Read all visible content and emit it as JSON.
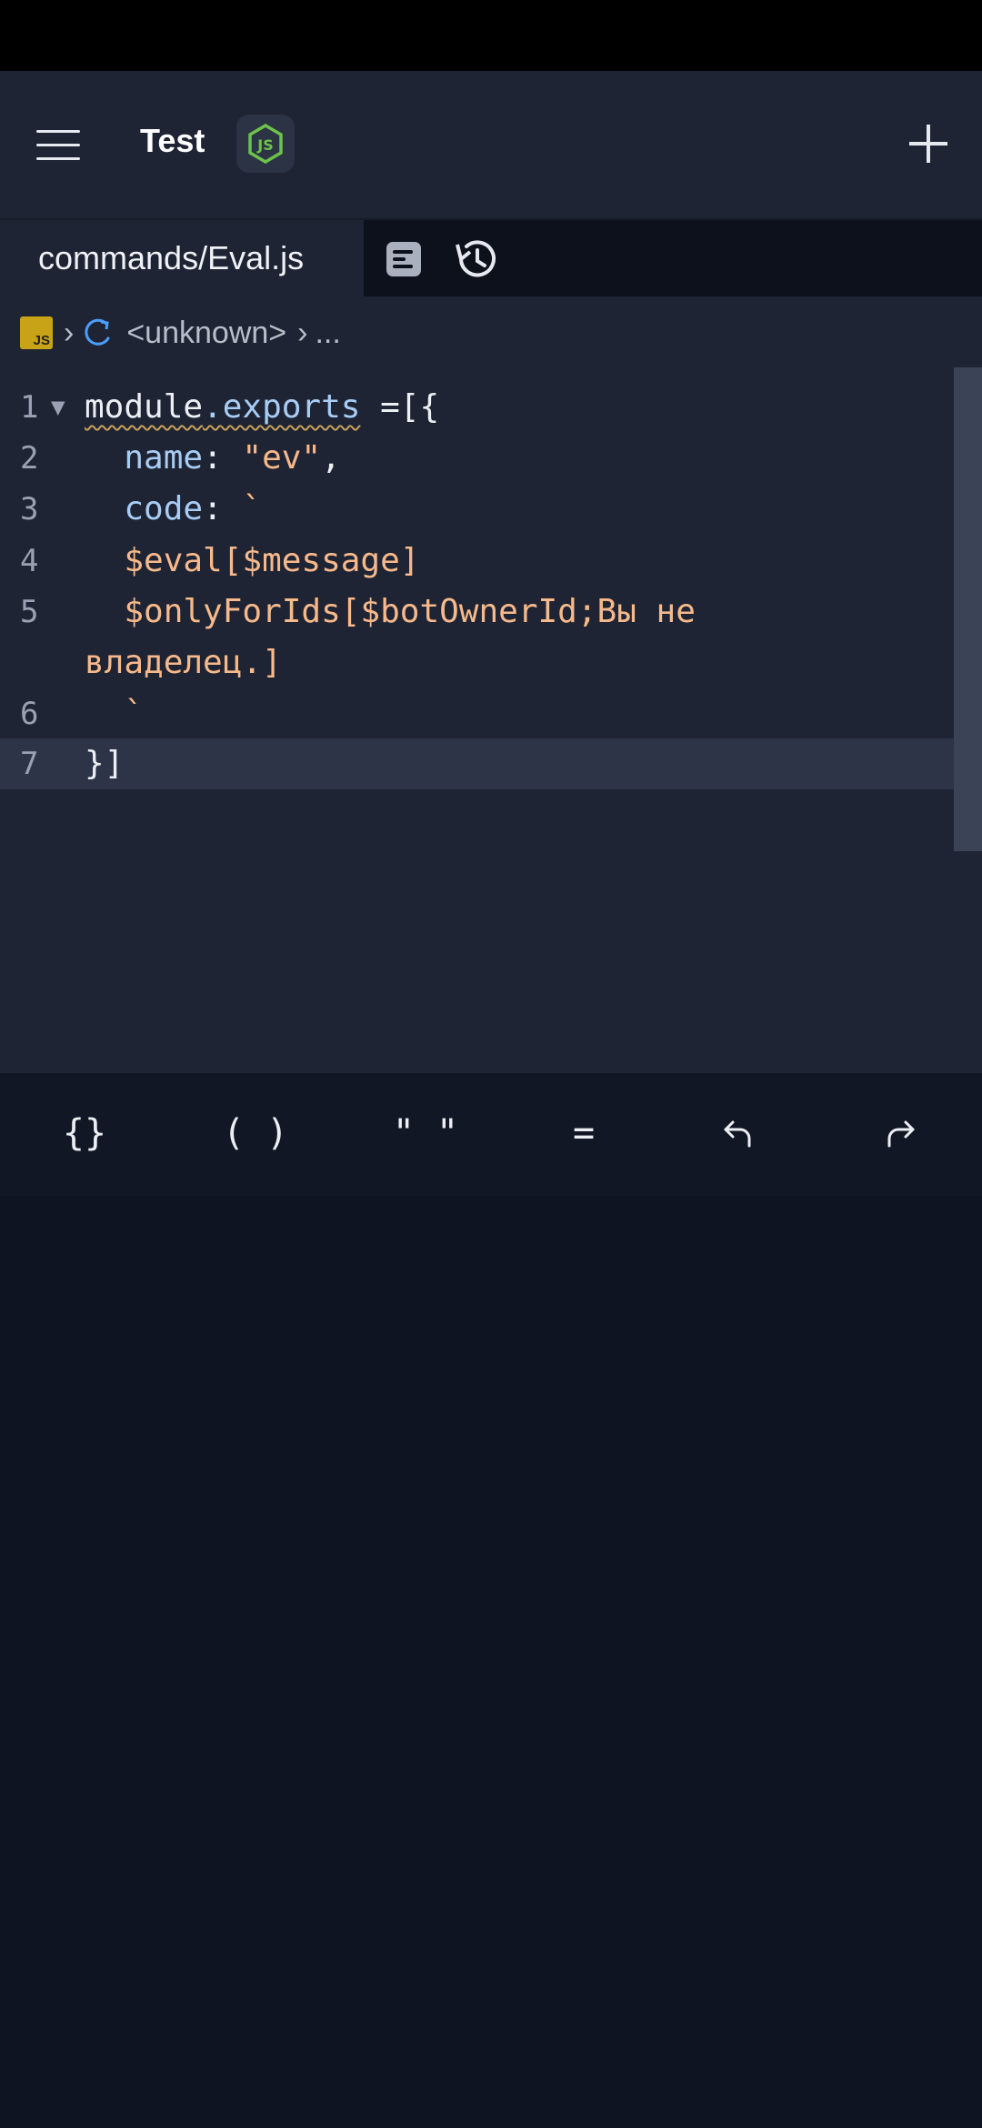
{
  "header": {
    "project_title": "Test",
    "runtime_icon": "nodejs-icon",
    "menu_icon": "hamburger-icon",
    "add_icon": "plus-icon"
  },
  "tabs": {
    "active_file": "commands/Eval.js",
    "icons": [
      "format-icon",
      "history-icon"
    ]
  },
  "breadcrumb": {
    "file_type_badge": "JS",
    "symbol_icon": "refresh-icon",
    "segment": "<unknown>",
    "ellipsis": "..."
  },
  "editor": {
    "lines": [
      {
        "number": "1"
      },
      {
        "number": "2"
      },
      {
        "number": "3"
      },
      {
        "number": "4"
      },
      {
        "number": "5"
      },
      {
        "number": "6"
      },
      {
        "number": "7"
      }
    ],
    "active_line": 7,
    "code": {
      "l1_module": "module",
      "l1_exports": ".exports",
      "l1_rest": " =[{",
      "l2_key": "  name",
      "l2_colon": ": ",
      "l2_value": "\"ev\"",
      "l2_comma": ",",
      "l3_key": "  code",
      "l3_colon": ": ",
      "l3_tick": "`",
      "l4_text": "  $eval[$message]",
      "l5_text": "  $onlyForIds[$botOwnerId;Вы не",
      "l5_wrap": "владелец.]",
      "l6_text": "  `",
      "l7_text": "}]"
    }
  },
  "toolbar": {
    "braces": "{}",
    "parens": "( )",
    "quotes": "\" \"",
    "equals": "=",
    "undo_icon": "undo-icon",
    "redo_icon": "redo-icon"
  },
  "colors": {
    "background": "#1e2433",
    "keyboard_area": "#0f1423",
    "string": "#f7b98b",
    "property": "#a8cdf5",
    "active_line": "#2d3447"
  }
}
